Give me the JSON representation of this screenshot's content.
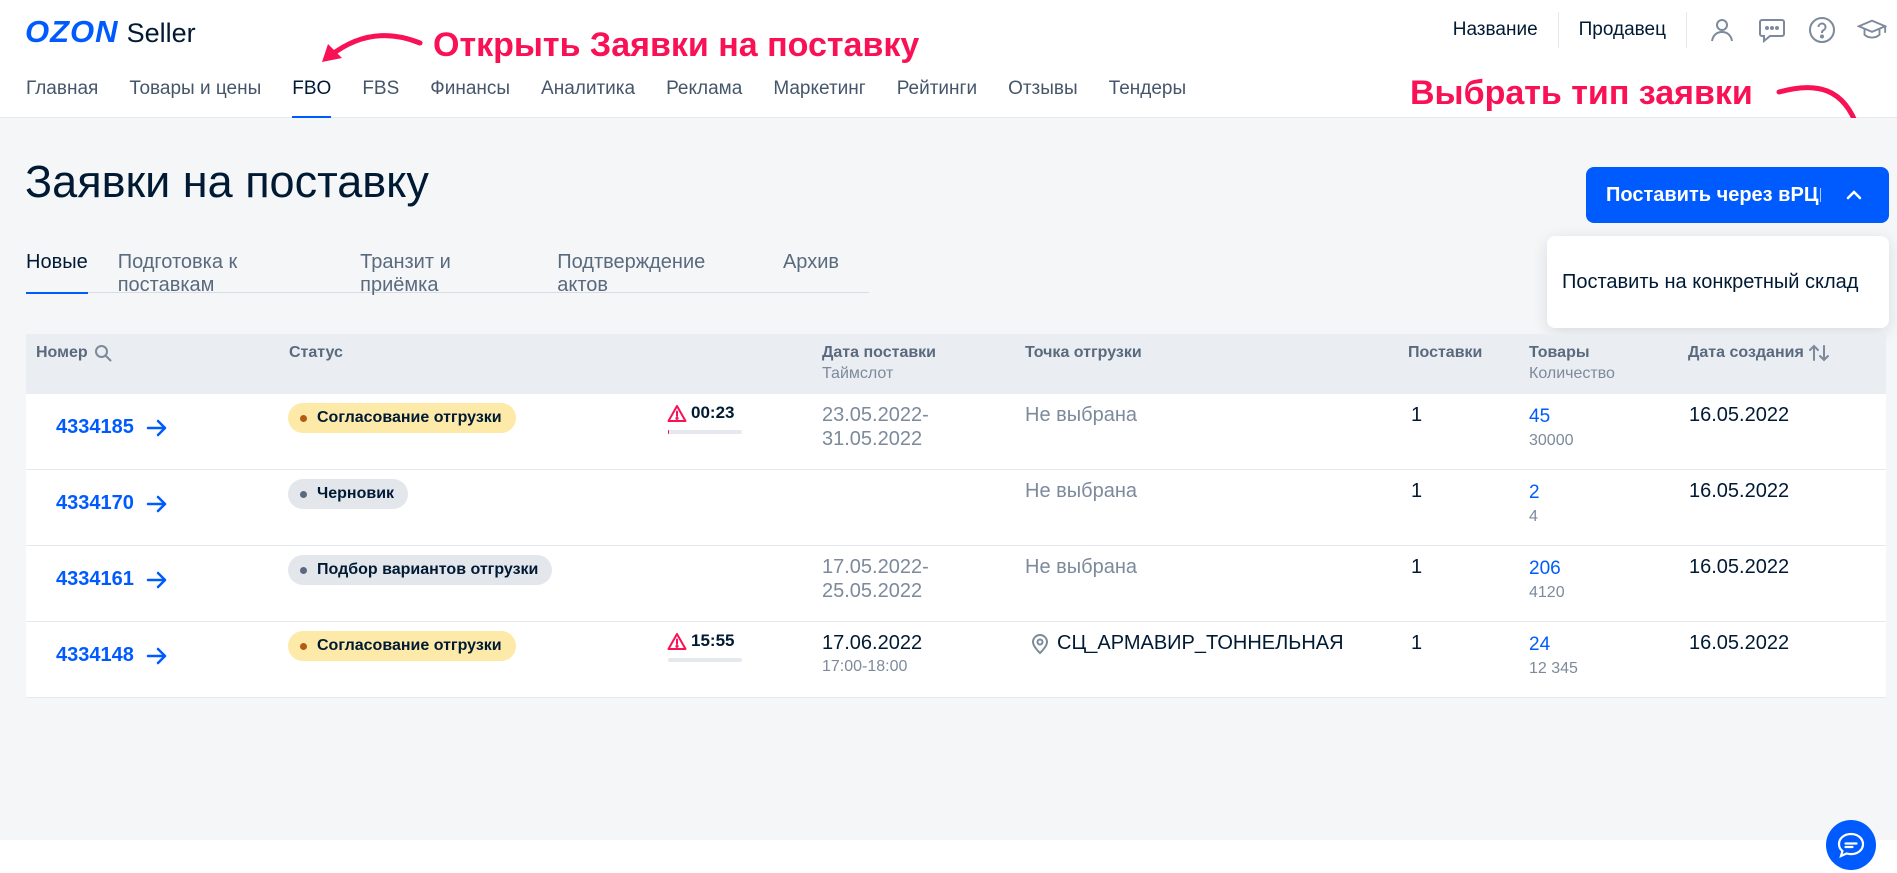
{
  "header": {
    "logo_brand": "OZON",
    "logo_suffix": "Seller",
    "top_links": [
      "Название",
      "Продавец"
    ],
    "icons": [
      "user-icon",
      "chat-icon",
      "help-icon",
      "education-icon"
    ],
    "nav": [
      {
        "label": "Главная",
        "active": false
      },
      {
        "label": "Товары и цены",
        "active": false
      },
      {
        "label": "FBO",
        "active": true
      },
      {
        "label": "FBS",
        "active": false
      },
      {
        "label": "Финансы",
        "active": false
      },
      {
        "label": "Аналитика",
        "active": false
      },
      {
        "label": "Реклама",
        "active": false
      },
      {
        "label": "Маркетинг",
        "active": false
      },
      {
        "label": "Рейтинги",
        "active": false
      },
      {
        "label": "Отзывы",
        "active": false
      },
      {
        "label": "Тендеры",
        "active": false
      }
    ]
  },
  "annotations": {
    "open_requests": "Открыть Заявки на поставку",
    "choose_type": "Выбрать тип заявки",
    "color": "#f91155"
  },
  "page": {
    "title": "Заявки на поставку",
    "tabs": [
      {
        "label": "Новые",
        "active": true
      },
      {
        "label": "Подготовка к поставкам",
        "active": false
      },
      {
        "label": "Транзит и приёмка",
        "active": false
      },
      {
        "label": "Подтверждение актов",
        "active": false
      },
      {
        "label": "Архив",
        "active": false
      }
    ],
    "primary_button": "Поставить через вРЦ",
    "dropdown_option": "Поставить на конкретный склад"
  },
  "table": {
    "headers": {
      "number": "Номер",
      "status": "Статус",
      "date": "Дата поставки",
      "date_sub": "Таймслот",
      "point": "Точка отгрузки",
      "supplies": "Поставки",
      "goods": "Товары",
      "goods_sub": "Количество",
      "created": "Дата создания"
    },
    "rows": [
      {
        "number": "4334185",
        "status": "Согласование отгрузки",
        "status_kind": "yellow",
        "timer": "00:23",
        "timer_progress": 0.02,
        "date_line1": "23.05.2022-",
        "date_line2": "31.05.2022",
        "date_muted": true,
        "point": "Не выбрана",
        "point_icon": false,
        "supplies": "1",
        "goods": "45",
        "quantity": "30000",
        "created": "16.05.2022"
      },
      {
        "number": "4334170",
        "status": "Черновик",
        "status_kind": "grey",
        "timer": "",
        "timer_progress": 0,
        "date_line1": "",
        "date_line2": "",
        "date_muted": true,
        "point": "Не выбрана",
        "point_icon": false,
        "supplies": "1",
        "goods": "2",
        "quantity": "4",
        "created": "16.05.2022"
      },
      {
        "number": "4334161",
        "status": "Подбор вариантов отгрузки",
        "status_kind": "grey",
        "timer": "",
        "timer_progress": 0,
        "date_line1": "17.05.2022-",
        "date_line2": "25.05.2022",
        "date_muted": true,
        "point": "Не выбрана",
        "point_icon": false,
        "supplies": "1",
        "goods": "206",
        "quantity": "4120",
        "created": "16.05.2022"
      },
      {
        "number": "4334148",
        "status": "Согласование отгрузки",
        "status_kind": "yellow",
        "timer": "15:55",
        "timer_progress": 0,
        "date_line1": "17.06.2022",
        "date_line2": "17:00-18:00",
        "date_muted": false,
        "point": "СЦ_АРМАВИР_ТОННЕЛЬНАЯ",
        "point_icon": true,
        "supplies": "1",
        "goods": "24",
        "quantity": "12 345",
        "created": "16.05.2022"
      }
    ]
  },
  "colors": {
    "brand_blue": "#005bff",
    "accent_pink": "#f91155",
    "badge_yellow": "#fde9a8",
    "badge_grey": "#e3e6eb"
  }
}
